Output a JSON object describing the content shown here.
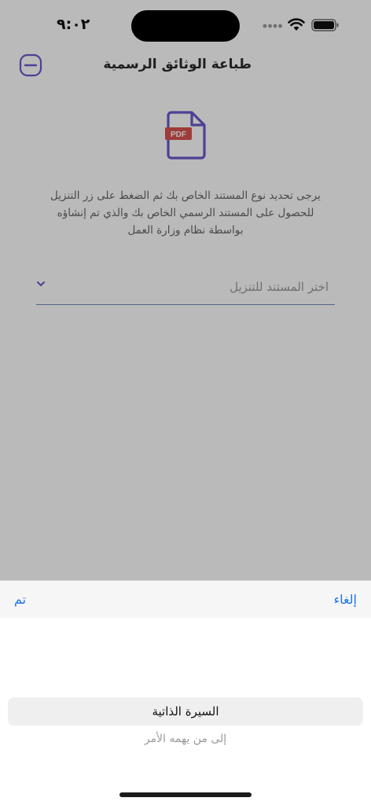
{
  "status_bar": {
    "time": "٩:٠٢"
  },
  "header": {
    "title": "طباعة الوثائق الرسمية",
    "collapse_icon": "minus-square-icon"
  },
  "document_icon": {
    "badge": "PDF",
    "icon": "pdf-file-icon"
  },
  "description": "يرجى تحديد نوع المستند الخاص بك ثم الضغط على زر التنزيل للحصول على المستند الرسمي الخاص بك والذي تم إنشاؤه بواسطة نظام وزارة العمل",
  "document_select": {
    "placeholder": "اختر المستند للتنزيل"
  },
  "picker_toolbar": {
    "done_label": "تم",
    "cancel_label": "إلغاء"
  },
  "picker": {
    "options": [
      "السيرة الذاتية",
      "إلى من يهمه الأمر"
    ],
    "selected": "السيرة الذاتية"
  },
  "colors": {
    "accent_purple": "#6a5acd",
    "link_blue": "#1a73e8",
    "badge_red": "#d9534f"
  }
}
